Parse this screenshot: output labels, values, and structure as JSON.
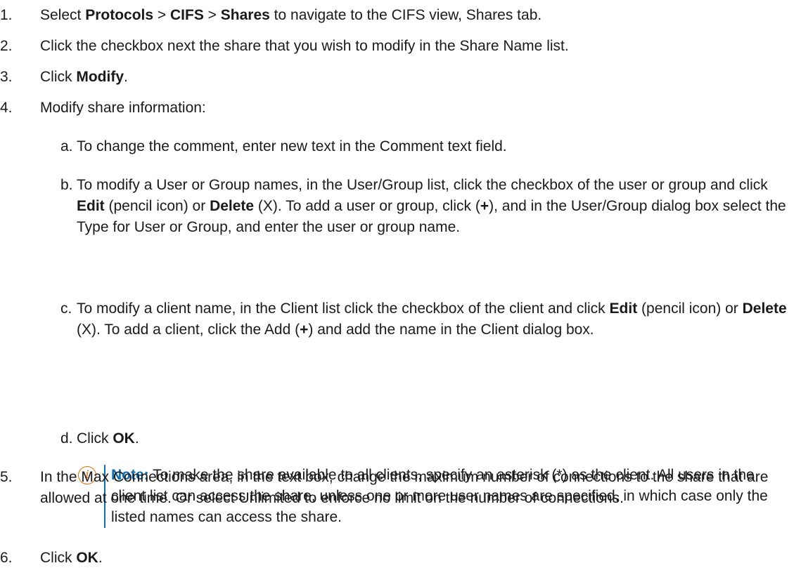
{
  "steps": [
    {
      "num": "1.",
      "parts": [
        {
          "t": "Select "
        },
        {
          "t": "Protocols",
          "b": true
        },
        {
          "t": " > "
        },
        {
          "t": "CIFS",
          "b": true
        },
        {
          "t": " > "
        },
        {
          "t": "Shares",
          "b": true
        },
        {
          "t": " to navigate to the CIFS view, Shares tab."
        }
      ]
    },
    {
      "num": "2.",
      "parts": [
        {
          "t": "Click the checkbox next the share that you wish to modify in the Share Name list."
        }
      ]
    },
    {
      "num": "3.",
      "parts": [
        {
          "t": "Click "
        },
        {
          "t": "Modify",
          "b": true
        },
        {
          "t": "."
        }
      ]
    },
    {
      "num": "4.",
      "parts": [
        {
          "t": "Modify share information:"
        }
      ]
    },
    {
      "num": "5.",
      "parts": [
        {
          "t": "In the Max Connections area, in the text box, change the maximum number of connections to the share that are allowed at one time. Or select Unlimited to enforce no limit on the number of connections."
        }
      ]
    },
    {
      "num": "6.",
      "parts": [
        {
          "t": "Click "
        },
        {
          "t": "OK",
          "b": true
        },
        {
          "t": "."
        }
      ]
    }
  ],
  "substeps": [
    {
      "letter": "a.",
      "parts": [
        {
          "t": "To change the comment, enter new text in the Comment text field."
        }
      ]
    },
    {
      "letter": "b.",
      "parts": [
        {
          "t": "To modify a User or Group names, in the User/Group list, click the checkbox of the user or group and click "
        },
        {
          "t": "Edit",
          "b": true
        },
        {
          "t": " (pencil icon) or "
        },
        {
          "t": "Delete",
          "b": true
        },
        {
          "t": " (X). To add a user or group, click ("
        },
        {
          "t": "+",
          "b": true
        },
        {
          "t": "), and in the User/Group dialog box select the Type for User or Group, and enter the user or group name."
        }
      ]
    },
    {
      "letter": "c.",
      "parts": [
        {
          "t": "To modify a client name, in the Client list click the checkbox of the client and click "
        },
        {
          "t": "Edit",
          "b": true
        },
        {
          "t": " (pencil icon) or "
        },
        {
          "t": "Delete",
          "b": true
        },
        {
          "t": " (X). To add a client, click the Add ("
        },
        {
          "t": "+",
          "b": true
        },
        {
          "t": ") and add the name in the Client dialog box."
        }
      ]
    },
    {
      "letter": "d.",
      "parts": [
        {
          "t": "Click "
        },
        {
          "t": "OK",
          "b": true
        },
        {
          "t": "."
        }
      ]
    }
  ],
  "note": {
    "icon": "info-icon",
    "icon_glyph": "i",
    "label": "Note:",
    "text": " To make the share available to all clients, specify an asterisk (*) as the client. All users in the client list can access the share, unless one or more user names are specified, in which case only the listed names can access the share.",
    "accent_color": "#0b6fb8",
    "icon_color": "#e07000"
  }
}
